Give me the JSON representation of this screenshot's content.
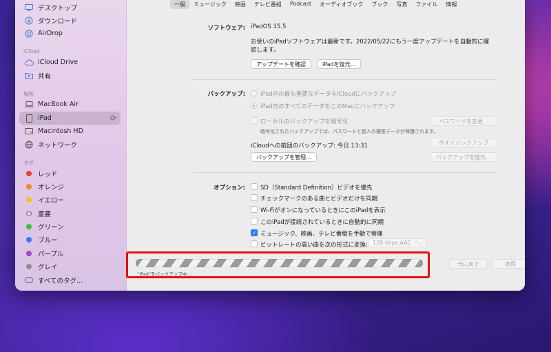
{
  "sidebar": {
    "items_top": [
      {
        "label": "デスクトップ",
        "icon": "desktop-icon"
      },
      {
        "label": "ダウンロード",
        "icon": "download-icon"
      },
      {
        "label": "AirDrop",
        "icon": "airdrop-icon"
      }
    ],
    "sections": {
      "icloud": "iCloud",
      "locations": "場所",
      "tags": "タグ"
    },
    "icloud_items": [
      {
        "label": "iCloud Drive",
        "icon": "cloud-icon"
      },
      {
        "label": "共有",
        "icon": "shared-folder-icon"
      }
    ],
    "location_items": [
      {
        "label": "MacBook Air",
        "icon": "laptop-icon"
      },
      {
        "label": "iPad",
        "icon": "ipad-icon"
      },
      {
        "label": "Macintosh HD",
        "icon": "disk-icon"
      },
      {
        "label": "ネットワーク",
        "icon": "network-icon"
      }
    ],
    "tag_items": [
      {
        "label": "レッド",
        "color": "#e8403a"
      },
      {
        "label": "オレンジ",
        "color": "#f08a24"
      },
      {
        "label": "イエロー",
        "color": "#f2c318"
      },
      {
        "label": "重要",
        "color": ""
      },
      {
        "label": "グリーン",
        "color": "#3ebd3e"
      },
      {
        "label": "ブルー",
        "color": "#2f7cf6"
      },
      {
        "label": "パープル",
        "color": "#a24ad0"
      },
      {
        "label": "グレイ",
        "color": "#8e8e93"
      },
      {
        "label": "すべてのタグ...",
        "color": ""
      }
    ]
  },
  "tabs": [
    "一般",
    "ミュージック",
    "映画",
    "テレビ番組",
    "Podcast",
    "オーディオブック",
    "ブック",
    "写真",
    "ファイル",
    "情報"
  ],
  "software": {
    "label": "ソフトウェア:",
    "version": "iPadOS 15.5",
    "message_line1": "お使いのiPadソフトウェアは最新です。2022/05/22にもう一度アップデートを自動的に確",
    "message_line2": "認します。",
    "check_update_button": "アップデートを確認",
    "restore_button": "iPadを復元..."
  },
  "backup": {
    "label": "バックアップ:",
    "option_icloud": "iPad内の最も重要なデータをiCloudにバックアップ",
    "option_mac": "iPad内のすべてのデータをこのMacにバックアップ",
    "encrypt_label": "ローカルのバックアップを暗号化",
    "encrypt_note": "暗号化されたバックアップでは、パスワードと個人の機密データが保護されます。",
    "change_password_button": "パスワードを変更...",
    "last_backup": "iCloudへの前回のバックアップ: 今日 13:31",
    "backup_now_button": "今すぐバックアップ",
    "manage_button": "バックアップを管理...",
    "restore_backup_button": "バックアップを復元..."
  },
  "options": {
    "label": "オプション:",
    "items": [
      {
        "label": "SD（Standard Definition）ビデオを優先",
        "checked": false
      },
      {
        "label": "チェックマークのある曲とビデオだけを同期",
        "checked": false
      },
      {
        "label": "Wi-FiがオンになっているときにこのiPadを表示",
        "checked": false
      },
      {
        "label": "このiPadが接続されているときに自動的に同期",
        "checked": false
      },
      {
        "label": "ミュージック、映画、テレビ番組を手動で管理",
        "checked": true
      },
      {
        "label": "ビットレートの高い曲を次の形式に変換:",
        "checked": false
      }
    ],
    "bitrate_value": "128 kbps AAC"
  },
  "footer": {
    "progress_text": "“iPad”をバックアップ中...",
    "revert_button": "元に戻す",
    "apply_button": "適用"
  }
}
